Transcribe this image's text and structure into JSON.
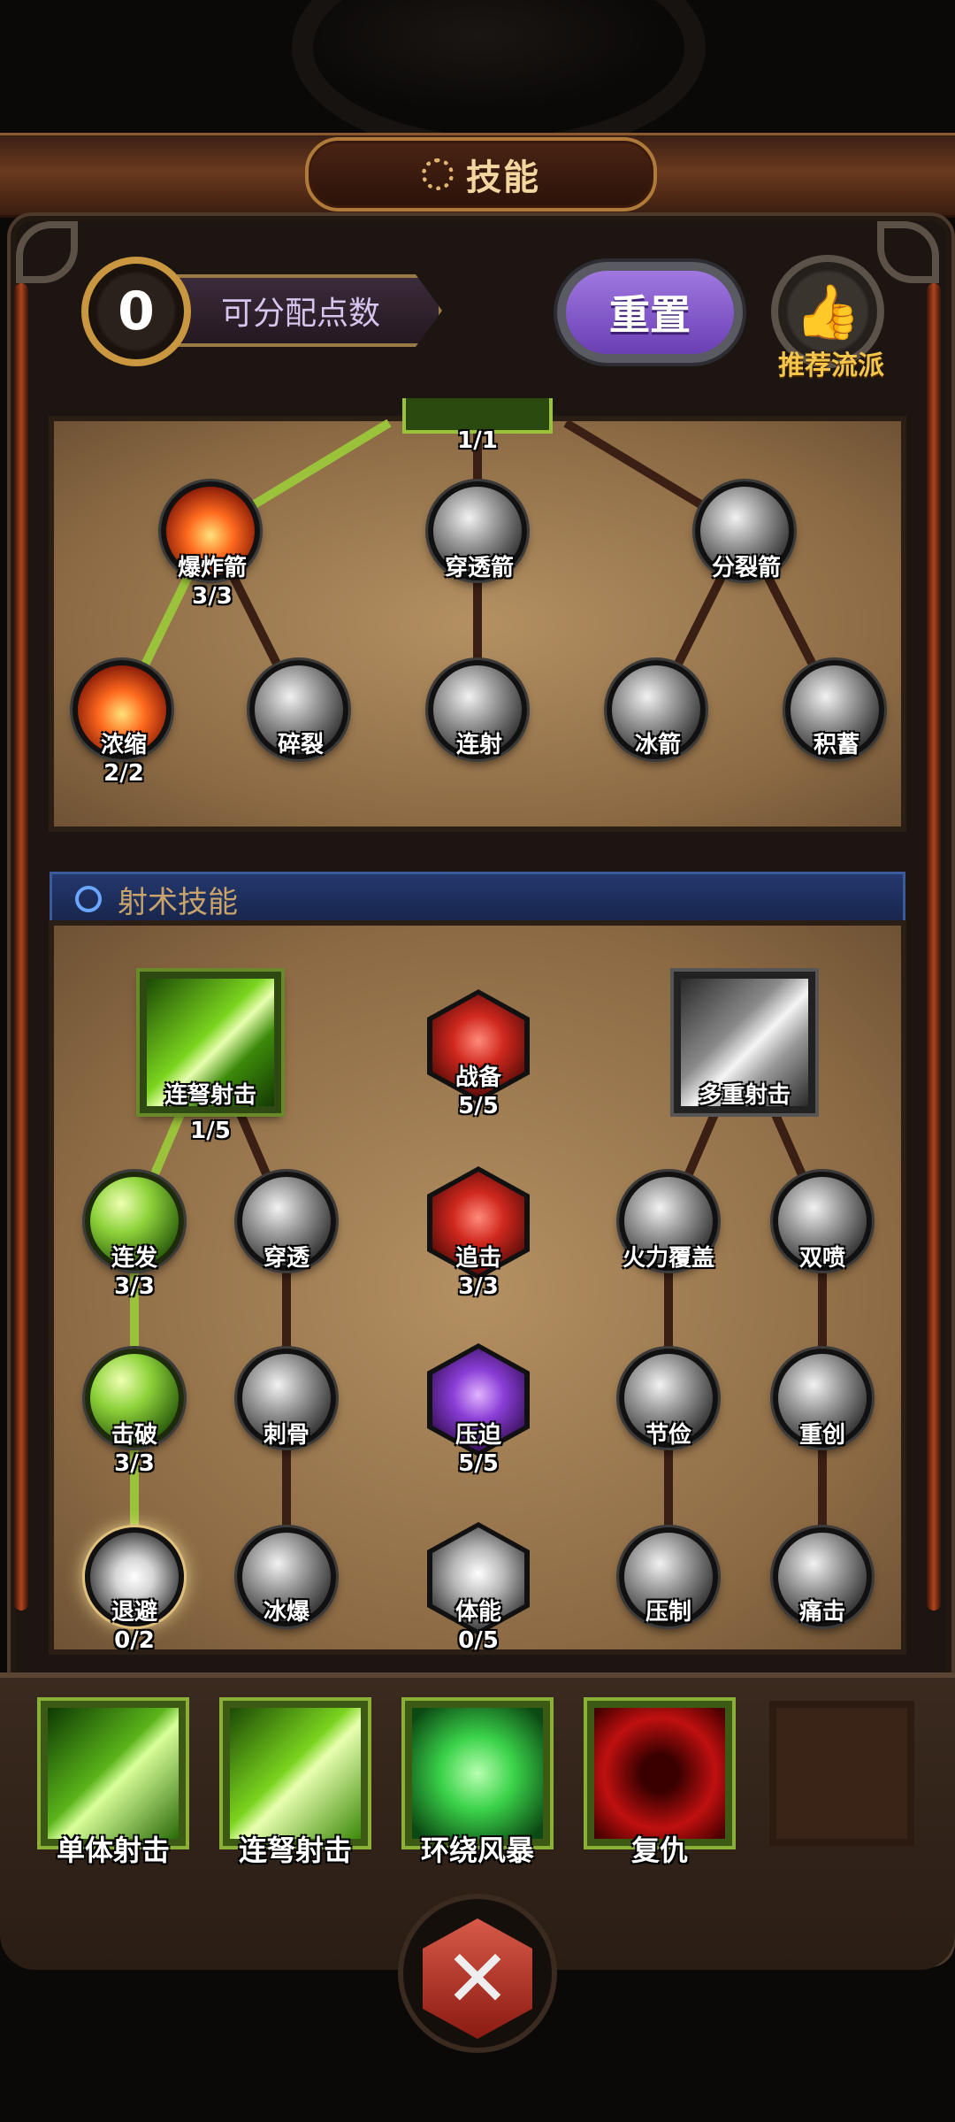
{
  "header": {
    "title": "技能"
  },
  "top": {
    "points_value": "0",
    "points_label": "可分配点数",
    "reset_label": "重置",
    "recommend_label": "推荐流派"
  },
  "tree1": {
    "top_node_level": "1/1",
    "nodes": [
      {
        "name": "爆炸箭",
        "level": "3/3"
      },
      {
        "name": "穿透箭",
        "level": ""
      },
      {
        "name": "分裂箭",
        "level": ""
      },
      {
        "name": "浓缩",
        "level": "2/2"
      },
      {
        "name": "碎裂",
        "level": ""
      },
      {
        "name": "连射",
        "level": ""
      },
      {
        "name": "冰箭",
        "level": ""
      },
      {
        "name": "积蓄",
        "level": ""
      }
    ]
  },
  "section": {
    "title": "射术技能"
  },
  "tree2": {
    "nodes": [
      {
        "name": "连弩射击",
        "level": "1/5"
      },
      {
        "name": "战备",
        "level": "5/5"
      },
      {
        "name": "多重射击",
        "level": ""
      },
      {
        "name": "连发",
        "level": "3/3"
      },
      {
        "name": "穿透",
        "level": ""
      },
      {
        "name": "追击",
        "level": "3/3"
      },
      {
        "name": "火力覆盖",
        "level": ""
      },
      {
        "name": "双喷",
        "level": ""
      },
      {
        "name": "击破",
        "level": "3/3"
      },
      {
        "name": "刺骨",
        "level": ""
      },
      {
        "name": "压迫",
        "level": "5/5"
      },
      {
        "name": "节俭",
        "level": ""
      },
      {
        "name": "重创",
        "level": ""
      },
      {
        "name": "退避",
        "level": "0/2"
      },
      {
        "name": "冰爆",
        "level": ""
      },
      {
        "name": "体能",
        "level": "0/5"
      },
      {
        "name": "压制",
        "level": ""
      },
      {
        "name": "痛击",
        "level": ""
      }
    ]
  },
  "skillbar": {
    "slots": [
      {
        "label": "单体射击"
      },
      {
        "label": "连弩射击"
      },
      {
        "label": "环绕风暴"
      },
      {
        "label": "复仇"
      }
    ]
  },
  "colors": {
    "accent_green": "#8dd23a",
    "reset_purple": "#8a5cd0",
    "gold": "#c8973f",
    "section_blue": "#23386e"
  },
  "icons": [
    "gear-icon",
    "thumbs-up-icon",
    "close-icon",
    "section-target-icon"
  ]
}
